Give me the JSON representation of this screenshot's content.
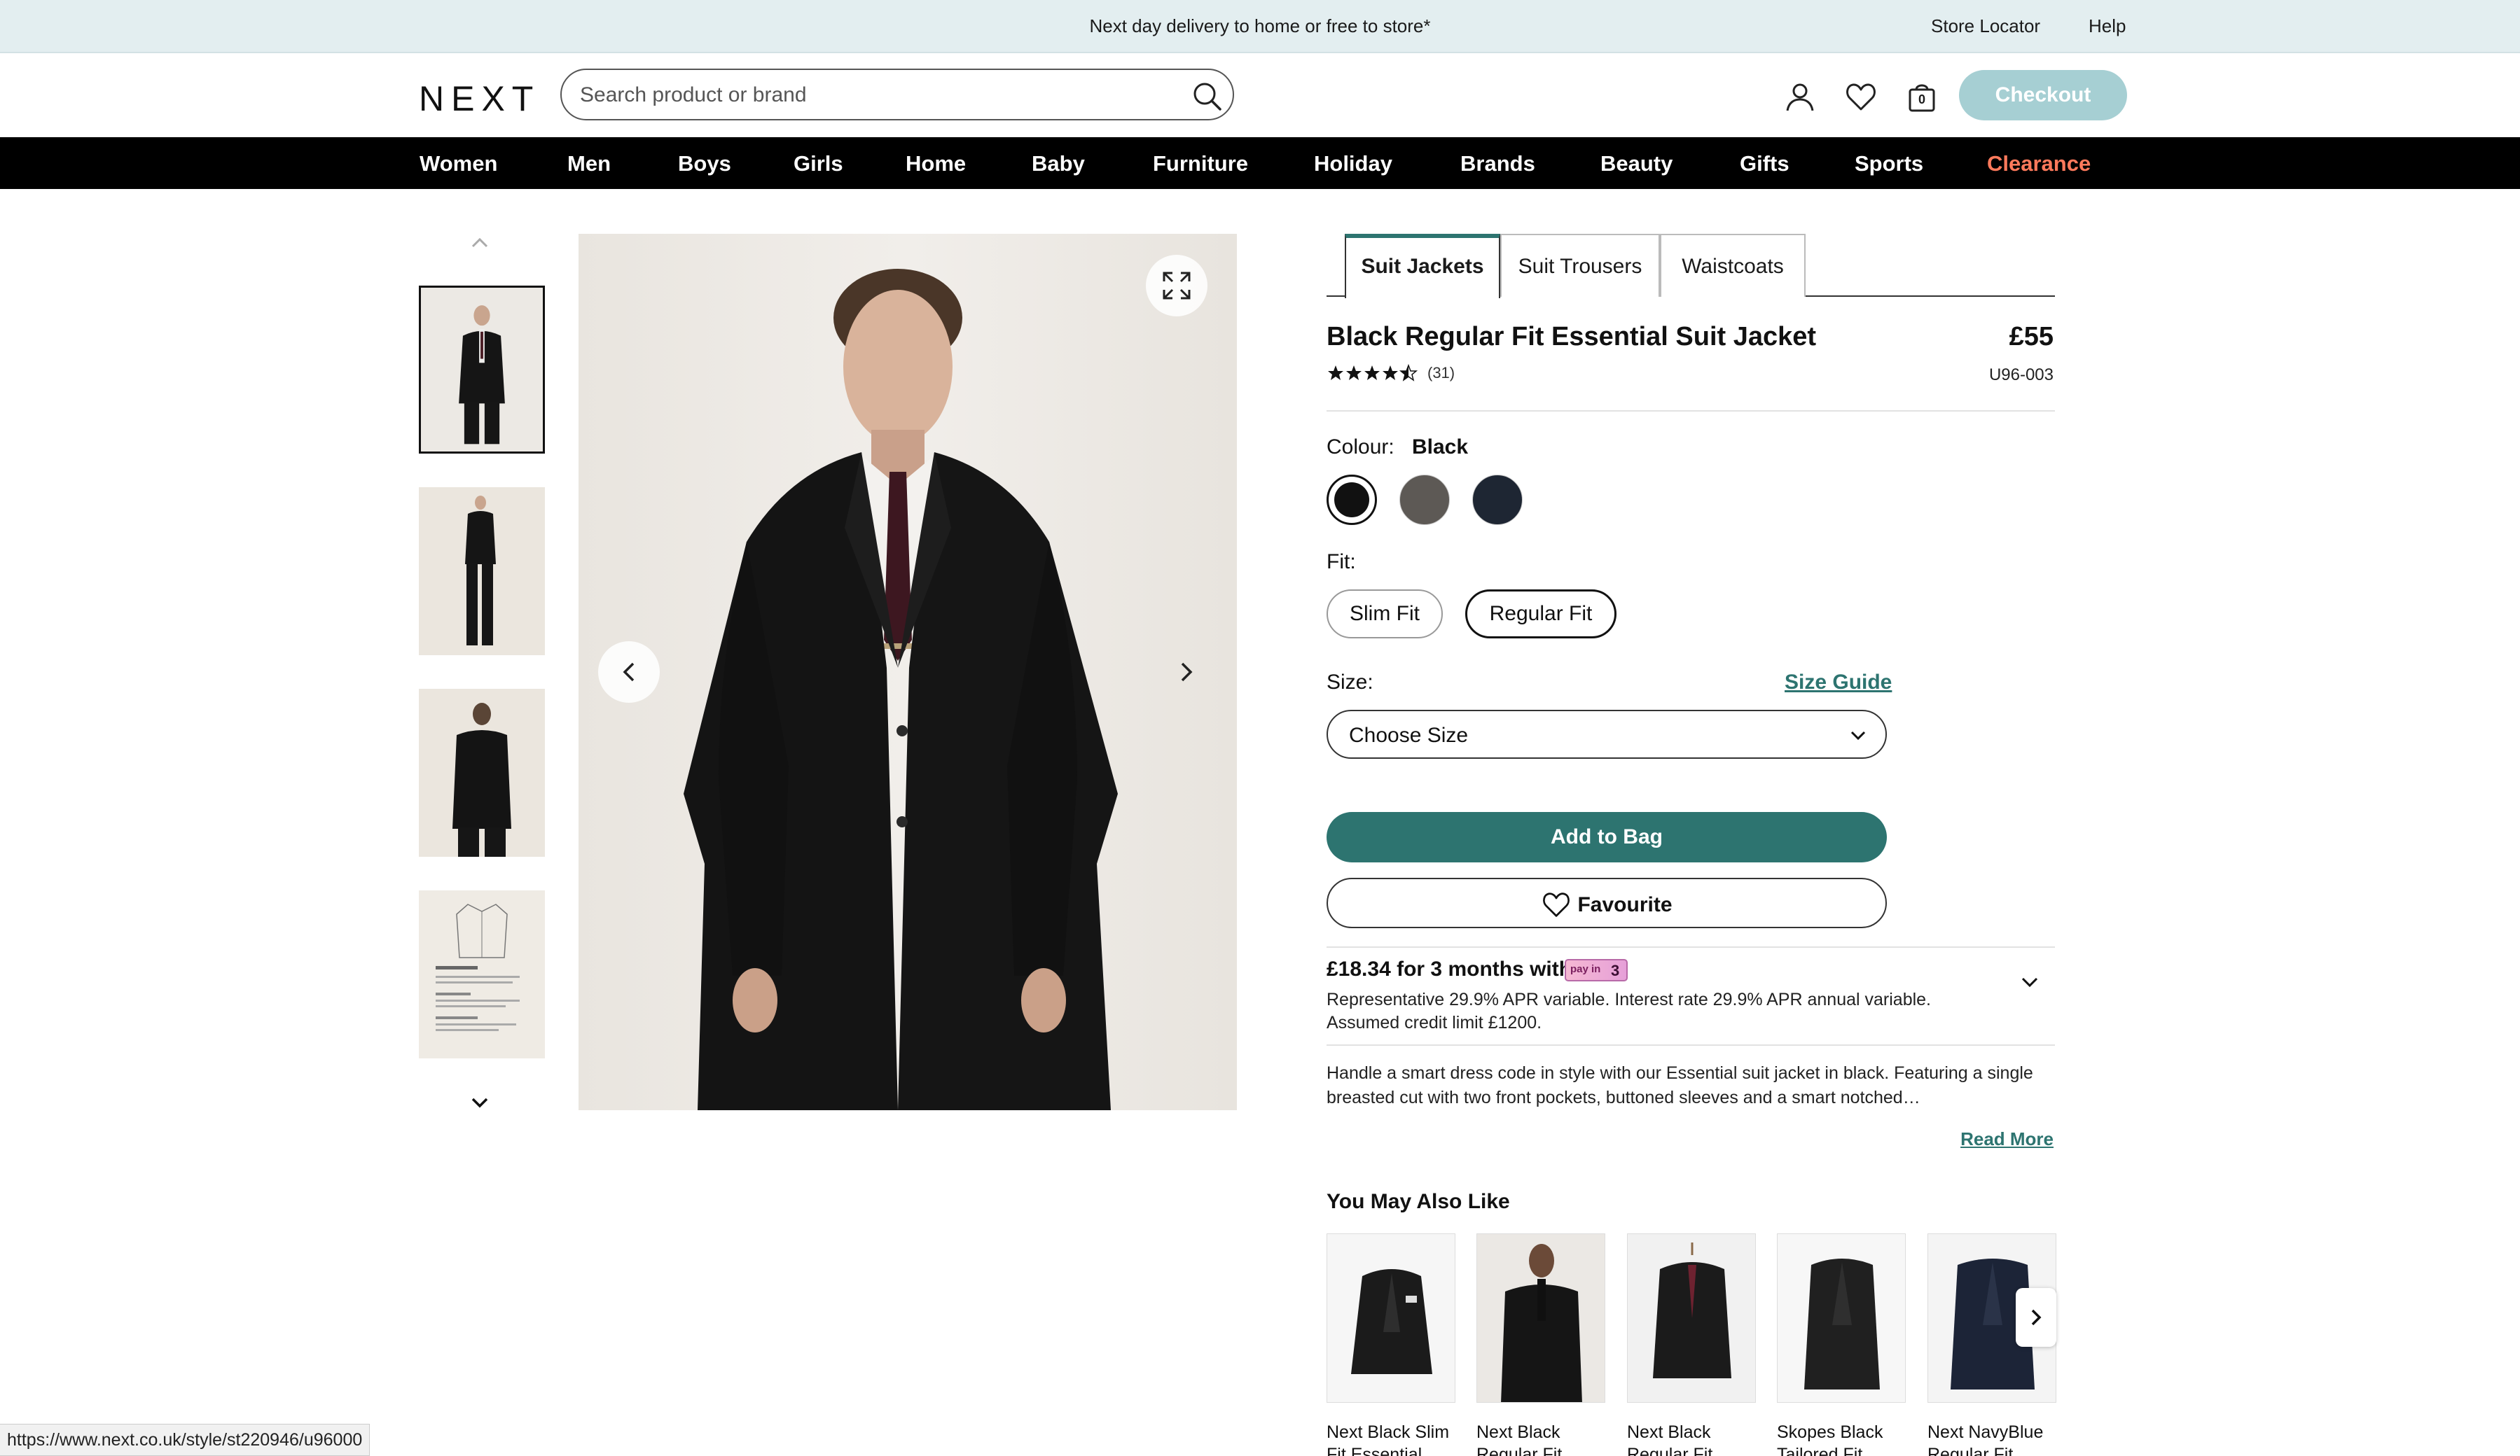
{
  "promo": {
    "text": "Next day delivery to home or free to store*",
    "store_locator": "Store Locator",
    "help": "Help"
  },
  "header": {
    "logo": "NEXT",
    "search_placeholder": "Search product or brand",
    "bag_count": "0",
    "checkout_label": "Checkout"
  },
  "nav": {
    "items": [
      "Women",
      "Men",
      "Boys",
      "Girls",
      "Home",
      "Baby",
      "Furniture",
      "Holiday",
      "Brands",
      "Beauty",
      "Gifts",
      "Sports",
      "Clearance"
    ]
  },
  "product": {
    "tabs": [
      "Suit Jackets",
      "Suit Trousers",
      "Waistcoats"
    ],
    "active_tab": "Suit Jackets",
    "title": "Black Regular Fit Essential Suit Jacket",
    "price": "£55",
    "code": "U96-003",
    "rating": 4.5,
    "rating_count": "(31)",
    "colour_label": "Colour:",
    "colour_value": "Black",
    "swatches": [
      {
        "name": "Black",
        "color": "#111111",
        "selected": true
      },
      {
        "name": "Grey",
        "color": "#5d5955",
        "selected": false
      },
      {
        "name": "Navy",
        "color": "#1e2633",
        "selected": false
      }
    ],
    "fit_label": "Fit:",
    "fits": [
      "Slim Fit",
      "Regular Fit"
    ],
    "selected_fit": "Regular Fit",
    "size_label": "Size:",
    "size_guide": "Size Guide",
    "size_select": "Choose Size",
    "add_to_bag": "Add to Bag",
    "favourite": "Favourite",
    "credit_headline": "£18.34 for 3 months with",
    "payin3_small": "pay in",
    "payin3_number": "3",
    "credit_line1": "Representative 29.9% APR variable. Interest rate 29.9% APR annual variable.",
    "credit_line2": "Assumed credit limit £1200.",
    "description": "Handle a smart dress code in style with our Essential suit jacket in black. Featuring a single breasted cut with two front pockets, buttoned sleeves and a smart notched…",
    "read_more": "Read More"
  },
  "recommendations": {
    "title": "You May Also Like",
    "items": [
      {
        "line1": "Next Black Slim",
        "line2": "Fit Essential"
      },
      {
        "line1": "Next Black",
        "line2": "Regular Fit"
      },
      {
        "line1": "Next Black",
        "line2": "Regular Fit"
      },
      {
        "line1": "Skopes Black",
        "line2": "Tailored Fit"
      },
      {
        "line1": "Next NavyBlue",
        "line2": "Regular Fit"
      }
    ]
  },
  "status_bar": {
    "url": "https://www.next.co.uk/style/st220946/u96000"
  },
  "colors": {
    "accent_teal": "#2d7470",
    "checkout_disabled": "#a6cfd3",
    "clearance": "#ff7a5c",
    "promo_bg": "#e3eef0"
  }
}
